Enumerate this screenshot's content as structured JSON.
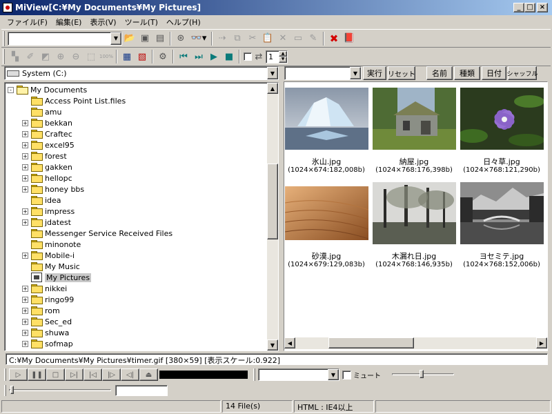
{
  "window": {
    "title": "MiView[C:¥My Documents¥My Pictures]"
  },
  "caption_buttons": {
    "minimize": "_",
    "maximize": "□",
    "close": "×"
  },
  "menu": [
    "ファイル(F)",
    "編集(E)",
    "表示(V)",
    "ツール(T)",
    "ヘルプ(H)"
  ],
  "toolbar2": {
    "spin_value": "1"
  },
  "drive": {
    "label": "System (C:)"
  },
  "right_toolbar": {
    "execute": "実行",
    "reset": "リセット",
    "sort_name": "名前",
    "sort_type": "種類",
    "sort_date": "日付",
    "shuffle": "シャッフル"
  },
  "tree": [
    {
      "label": "My Documents",
      "expander": "-",
      "indent": 0,
      "icon": "open"
    },
    {
      "label": "Access Point List.files",
      "expander": "",
      "indent": 1,
      "icon": "folder"
    },
    {
      "label": "amu",
      "expander": "",
      "indent": 1,
      "icon": "folder"
    },
    {
      "label": "bekkan",
      "expander": "+",
      "indent": 1,
      "icon": "folder"
    },
    {
      "label": "Craftec",
      "expander": "+",
      "indent": 1,
      "icon": "folder"
    },
    {
      "label": "excel95",
      "expander": "+",
      "indent": 1,
      "icon": "folder"
    },
    {
      "label": "forest",
      "expander": "+",
      "indent": 1,
      "icon": "folder"
    },
    {
      "label": "gakken",
      "expander": "+",
      "indent": 1,
      "icon": "folder"
    },
    {
      "label": "hellopc",
      "expander": "+",
      "indent": 1,
      "icon": "folder"
    },
    {
      "label": "honey bbs",
      "expander": "+",
      "indent": 1,
      "icon": "folder"
    },
    {
      "label": "idea",
      "expander": "",
      "indent": 1,
      "icon": "folder"
    },
    {
      "label": "impress",
      "expander": "+",
      "indent": 1,
      "icon": "folder"
    },
    {
      "label": "jdatest",
      "expander": "+",
      "indent": 1,
      "icon": "folder"
    },
    {
      "label": "Messenger Service Received Files",
      "expander": "",
      "indent": 1,
      "icon": "folder"
    },
    {
      "label": "minonote",
      "expander": "",
      "indent": 1,
      "icon": "folder"
    },
    {
      "label": "Mobile-i",
      "expander": "+",
      "indent": 1,
      "icon": "folder"
    },
    {
      "label": "My Music",
      "expander": "",
      "indent": 1,
      "icon": "folder"
    },
    {
      "label": "My Pictures",
      "expander": "",
      "indent": 1,
      "icon": "special",
      "selected": true
    },
    {
      "label": "nikkei",
      "expander": "+",
      "indent": 1,
      "icon": "folder"
    },
    {
      "label": "ringo99",
      "expander": "+",
      "indent": 1,
      "icon": "folder"
    },
    {
      "label": "rom",
      "expander": "+",
      "indent": 1,
      "icon": "folder"
    },
    {
      "label": "Sec_ed",
      "expander": "+",
      "indent": 1,
      "icon": "folder"
    },
    {
      "label": "shuwa",
      "expander": "+",
      "indent": 1,
      "icon": "folder"
    },
    {
      "label": "sofmap",
      "expander": "+",
      "indent": 1,
      "icon": "folder"
    }
  ],
  "thumbnails": [
    {
      "name": "氷山.jpg",
      "meta": "(1024×674:182,008b)",
      "scene": "iceberg"
    },
    {
      "name": "納屋.jpg",
      "meta": "(1024×768:176,398b)",
      "scene": "barn"
    },
    {
      "name": "日々草.jpg",
      "meta": "(1024×768:121,290b)",
      "scene": "flower"
    },
    {
      "name": "砂漠.jpg",
      "meta": "(1024×679:129,083b)",
      "scene": "desert"
    },
    {
      "name": "木漏れ日.jpg",
      "meta": "(1024×768:146,935b)",
      "scene": "trees"
    },
    {
      "name": "ヨセミテ.jpg",
      "meta": "(1024×768:152,006b)",
      "scene": "yosemite"
    }
  ],
  "info_bar": "C:¥My Documents¥My Pictures¥timer.gif [380×59] [表示スケール:0.922]",
  "player": {
    "mute_label": "ミュート"
  },
  "status": {
    "files": "14 File(s)",
    "html": "HTML : IE4以上"
  }
}
